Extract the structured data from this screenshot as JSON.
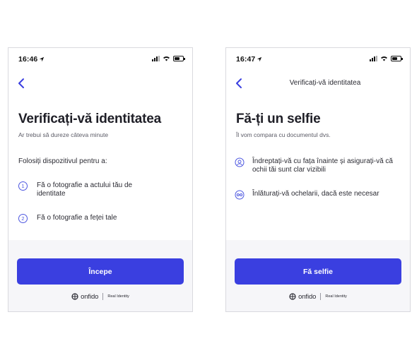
{
  "colors": {
    "accent": "#3a3fe0",
    "step_outline": "#4d57e0",
    "bottom_bg": "#f6f6f9"
  },
  "screens": [
    {
      "status_time": "16:46",
      "header_title": "",
      "title": "Verificați-vă identitatea",
      "subtitle": "Ar trebui să dureze câteva minute",
      "intro": "Folosiți dispozitivul pentru a:",
      "steps": [
        {
          "num": "1",
          "text": "Fă o fotografie a actului tău de identitate"
        },
        {
          "num": "2",
          "text": "Fă o fotografie a feței tale"
        }
      ],
      "button_label": "Începe",
      "brand_name": "onfido",
      "brand_tag": "Real Identity"
    },
    {
      "status_time": "16:47",
      "header_title": "Verificați-vă identitatea",
      "title": "Fă-ți un selfie",
      "subtitle": "Îl vom compara cu documentul dvs.",
      "guidance": [
        {
          "icon": "face-icon",
          "text": "Îndreptați-vă cu fața înainte și asigurați-vă că ochii tăi sunt clar vizibili"
        },
        {
          "icon": "glasses-icon",
          "text": "Înlăturați-vă ochelarii, dacă este necesar"
        }
      ],
      "button_label": "Fă selfie",
      "brand_name": "onfido",
      "brand_tag": "Real Identity"
    }
  ]
}
